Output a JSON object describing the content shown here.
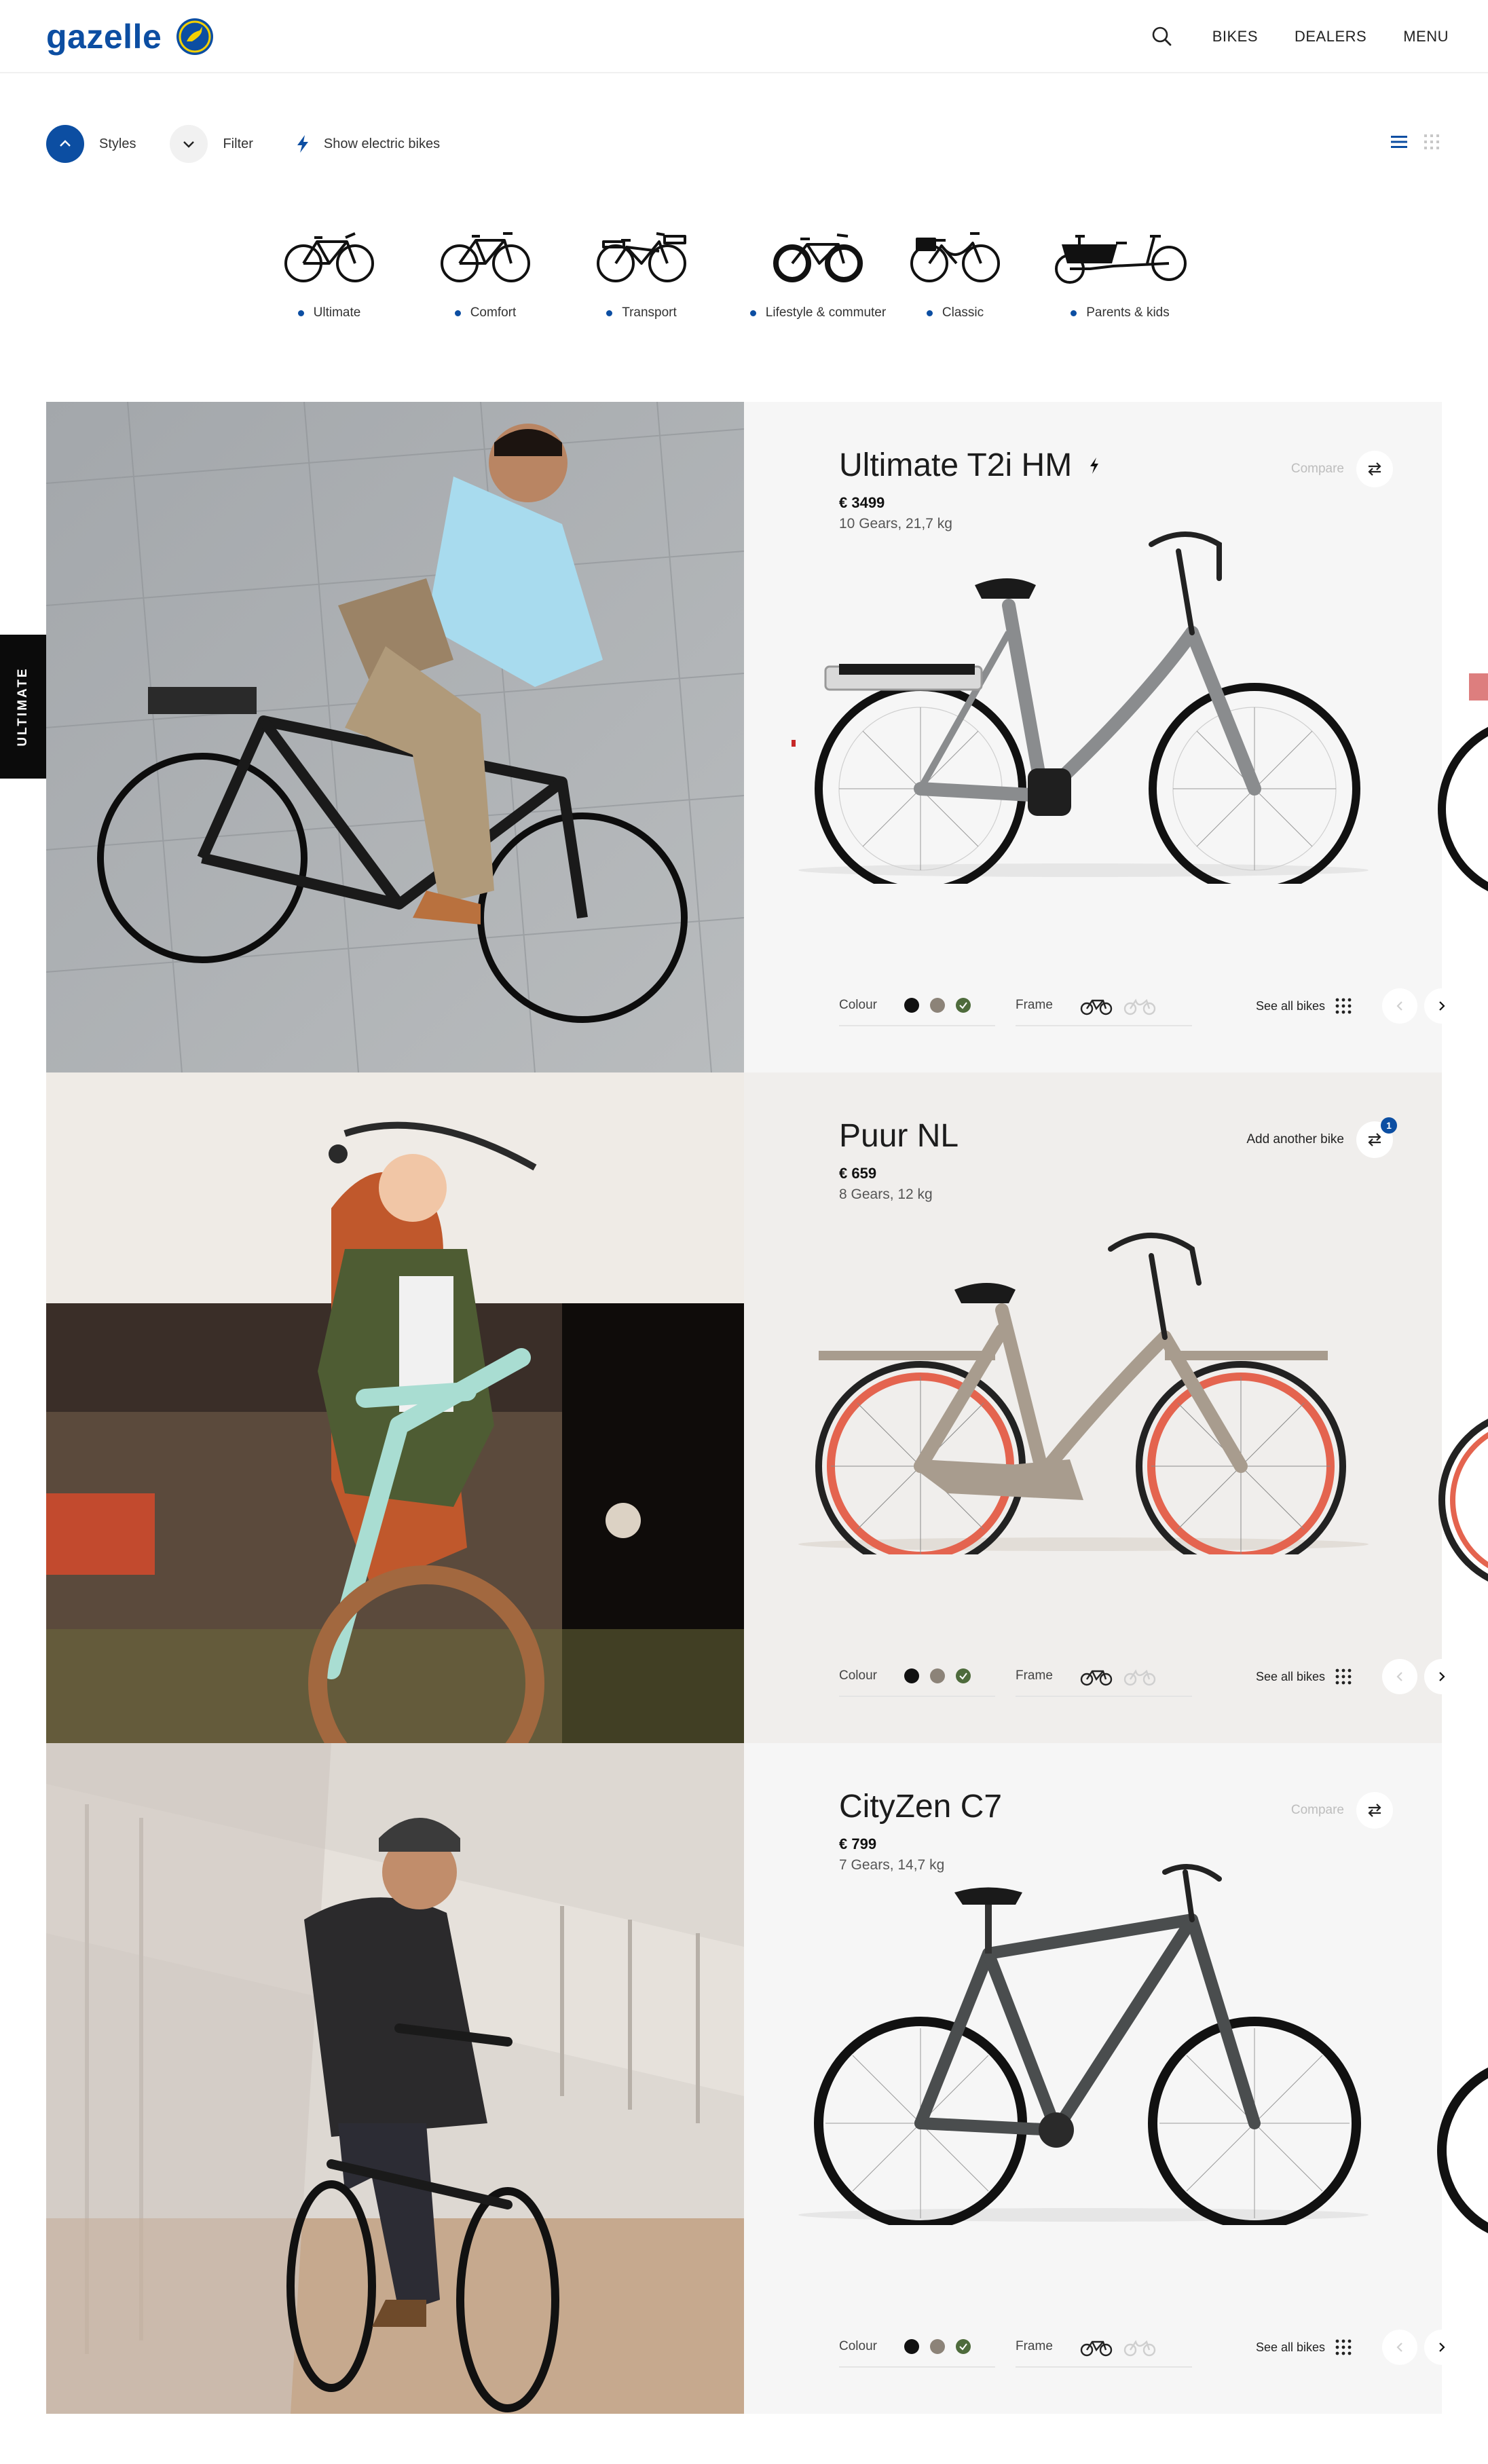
{
  "header": {
    "logo_text": "gazelle",
    "nav": {
      "bikes": "BIKES",
      "dealers": "DEALERS",
      "menu": "MENU"
    }
  },
  "filters": {
    "styles_label": "Styles",
    "filter_label": "Filter",
    "electric_label": "Show electric bikes"
  },
  "categories": [
    {
      "label": "Ultimate"
    },
    {
      "label": "Comfort"
    },
    {
      "label": "Transport"
    },
    {
      "label": "Lifestyle & commuter"
    },
    {
      "label": "Classic"
    },
    {
      "label": "Parents & kids"
    }
  ],
  "side_tag": "ULTIMATE",
  "bikes": [
    {
      "name": "Ultimate T2i HM",
      "electric": true,
      "price": "€ 3499",
      "specs": "10 Gears, 21,7 kg",
      "compare_label": "Compare",
      "colour_label": "Colour",
      "frame_label": "Frame",
      "see_all": "See all bikes",
      "frame_color": "#8a8c8e"
    },
    {
      "name": "Puur NL",
      "electric": false,
      "price": "€ 659",
      "specs": "8 Gears, 12 kg",
      "compare_label": "Add another bike",
      "compare_count": "1",
      "colour_label": "Colour",
      "frame_label": "Frame",
      "see_all": "See all bikes",
      "frame_color": "#a89c8e"
    },
    {
      "name": "CityZen C7",
      "electric": false,
      "price": "€ 799",
      "specs": "7 Gears, 14,7 kg",
      "compare_label": "Compare",
      "colour_label": "Colour",
      "frame_label": "Frame",
      "see_all": "See all bikes",
      "frame_color": "#4a4d4e"
    }
  ],
  "swatch_colors": [
    "#111111",
    "#8c8378",
    "#4e6b3c"
  ],
  "brand_color": "#0c4ea2"
}
